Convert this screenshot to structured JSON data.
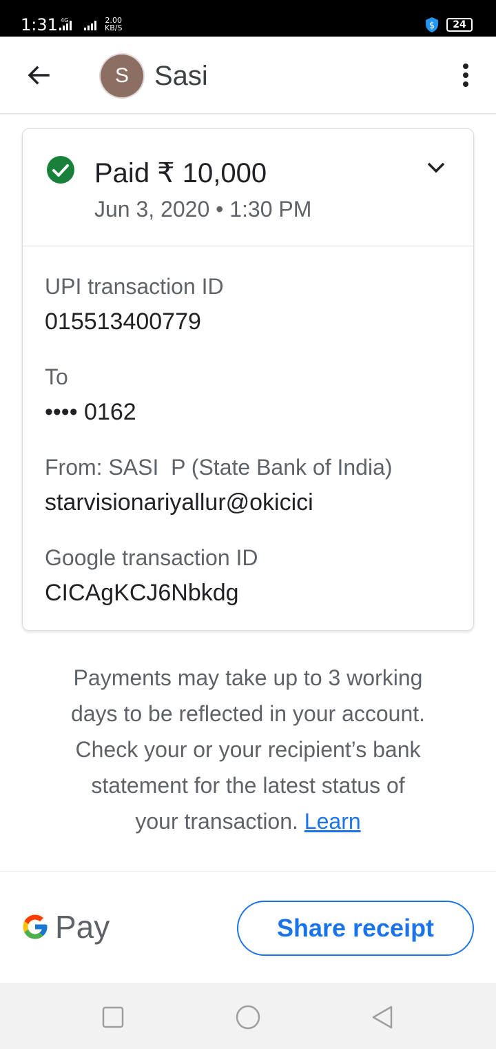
{
  "status_bar": {
    "time": "1:31",
    "network": "4G",
    "speed_value": "2.00",
    "speed_unit": "KB/S",
    "battery": "24"
  },
  "header": {
    "avatar_initial": "S",
    "contact_name": "Sasi"
  },
  "payment": {
    "status": "Paid ₹ 10,000",
    "datetime": "Jun 3, 2020 • 1:30 PM",
    "status_color": "#188038"
  },
  "details": {
    "upi_label": "UPI transaction ID",
    "upi_value": "015513400779",
    "to_label": "To",
    "to_value": "•••• 0162",
    "from_label": "From: SASI  P (State Bank of India)",
    "from_value": "starvisionariyallur@okicici",
    "google_label": "Google transaction ID",
    "google_value": "CICAgKCJ6Nbkdg"
  },
  "info": {
    "text": "Payments may take up to 3 working days to be reflected in your account. Check your or your recipient’s bank statement for the latest status of your transaction.",
    "learn_link": "Learn"
  },
  "footer": {
    "brand_text": "Pay",
    "share_label": "Share receipt",
    "accent_color": "#1a73e8"
  }
}
